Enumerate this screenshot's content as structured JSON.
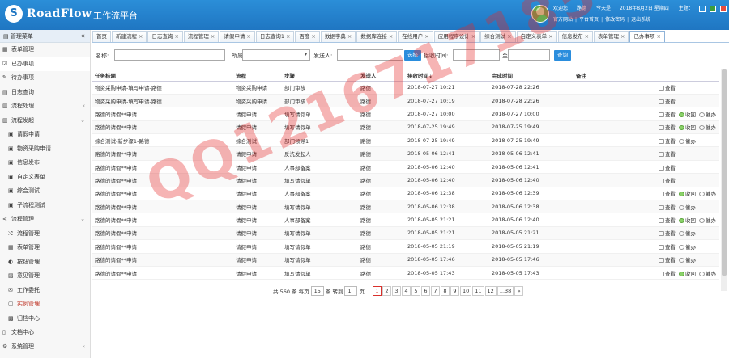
{
  "header": {
    "logo_glyph": "S",
    "brand": "RoadFlow",
    "brand_sub": "工作流平台",
    "welcome": "欢迎您：",
    "user": "路德",
    "today_label": "今天是：",
    "date": "2018年8月2日 星期四",
    "theme_label": "主题：",
    "links": [
      "官方网站",
      "平台首页",
      "修改密码",
      "退出系统"
    ],
    "theme_colors": [
      "#2b8ed8",
      "#3c9d3c",
      "#e74c3c"
    ]
  },
  "sidebar": {
    "title": "管理菜单",
    "items": [
      {
        "icon": "table-icon",
        "label": "表单管理",
        "level": 0
      },
      {
        "icon": "check-icon",
        "label": "已办事项",
        "level": 0,
        "active": true
      },
      {
        "icon": "edit-icon",
        "label": "待办事项",
        "level": 0
      },
      {
        "icon": "log-icon",
        "label": "日志查询",
        "level": 0
      },
      {
        "icon": "flow-icon",
        "label": "流程处理",
        "level": 0,
        "arrow": "‹"
      },
      {
        "icon": "flow-icon",
        "label": "流程发起",
        "level": 0,
        "arrow": "⌄"
      },
      {
        "icon": "doc-icon",
        "label": "请假申请",
        "level": 1
      },
      {
        "icon": "doc-icon",
        "label": "物资采购申请",
        "level": 1
      },
      {
        "icon": "doc-icon",
        "label": "信息发布",
        "level": 1
      },
      {
        "icon": "doc-icon",
        "label": "自定义表单",
        "level": 1
      },
      {
        "icon": "doc-icon",
        "label": "综合测试",
        "level": 1
      },
      {
        "icon": "doc-icon",
        "label": "子流程测试",
        "level": 1
      },
      {
        "icon": "share-icon",
        "label": "流程管理",
        "level": 0,
        "arrow": "⌄"
      },
      {
        "icon": "shuffle-icon",
        "label": "流程管理",
        "level": 1
      },
      {
        "icon": "table-icon",
        "label": "表单管理",
        "level": 1
      },
      {
        "icon": "toggle-icon",
        "label": "按钮管理",
        "level": 1
      },
      {
        "icon": "image-icon",
        "label": "意见管理",
        "level": 1
      },
      {
        "icon": "entrust-icon",
        "label": "工作委托",
        "level": 1
      },
      {
        "icon": "instance-icon",
        "label": "实例管理",
        "level": 1,
        "red": true
      },
      {
        "icon": "archive-icon",
        "label": "归档中心",
        "level": 1
      },
      {
        "icon": "file-icon",
        "label": "文档中心",
        "level": 0
      },
      {
        "icon": "gear-icon",
        "label": "系统管理",
        "level": 0,
        "arrow": "‹"
      }
    ]
  },
  "tabs": [
    "首页",
    "新建流程",
    "日志查询",
    "流程管理",
    "请假申请",
    "日志查询1",
    "百度",
    "数据字典",
    "数据库连接",
    "在线用户",
    "应用程序设计",
    "综合测试",
    "自定义表单",
    "信息发布",
    "表单管理",
    "已办事项"
  ],
  "search": {
    "name_label": "名称:",
    "flow_label": "所属流程:",
    "sender_label": "发送人:",
    "select_btn": "选择",
    "recv_time_label": "接收时间:",
    "to_label": "至",
    "query_btn": "查询"
  },
  "table": {
    "headers": [
      "任务标题",
      "流程",
      "步骤",
      "发送人",
      "接收时间",
      "完成时间",
      "备注",
      ""
    ],
    "sort_mark": "⇣",
    "action_labels": {
      "view": "查看",
      "withdraw": "收回",
      "urge": "催办"
    },
    "rows": [
      {
        "title": "物资采购申请-填写申请-路德",
        "flow": "物资采购申请",
        "step": "部门审核",
        "sender": "路德",
        "recv": "2018-07-27 10:21",
        "done": "2018-07-28 22:26",
        "actions": [
          "view"
        ]
      },
      {
        "title": "物资采购申请-填写申请-路德",
        "flow": "物资采购申请",
        "step": "部门审核",
        "sender": "路德",
        "recv": "2018-07-27 10:19",
        "done": "2018-07-28 22:26",
        "actions": [
          "view"
        ]
      },
      {
        "title": "路德的请假**申请",
        "flow": "请假申请",
        "step": "填写请假单",
        "sender": "路德",
        "recv": "2018-07-27 10:00",
        "done": "2018-07-27 10:00",
        "actions": [
          "view",
          "withdraw",
          "urge"
        ]
      },
      {
        "title": "路德的请假**申请",
        "flow": "请假申请",
        "step": "填写请假单",
        "sender": "路德",
        "recv": "2018-07-25 19:49",
        "done": "2018-07-25 19:49",
        "actions": [
          "view",
          "withdraw",
          "urge"
        ]
      },
      {
        "title": "综合测试-新步骤1-路德",
        "flow": "综合测试",
        "step": "部门领导1",
        "sender": "路德",
        "recv": "2018-07-25 19:49",
        "done": "2018-07-25 19:49",
        "actions": [
          "view",
          "urge"
        ]
      },
      {
        "title": "路德的请假**申请",
        "flow": "请假申请",
        "step": "反洗发起人",
        "sender": "路德",
        "recv": "2018-05-06 12:41",
        "done": "2018-05-06 12:41",
        "actions": [
          "view"
        ]
      },
      {
        "title": "路德的请假**申请",
        "flow": "请假申请",
        "step": "人事部备案",
        "sender": "路德",
        "recv": "2018-05-06 12:40",
        "done": "2018-05-06 12:41",
        "actions": [
          "view"
        ]
      },
      {
        "title": "路德的请假**申请",
        "flow": "请假申请",
        "step": "填写请假单",
        "sender": "路德",
        "recv": "2018-05-06 12:40",
        "done": "2018-05-06 12:40",
        "actions": [
          "view"
        ]
      },
      {
        "title": "路德的请假**申请",
        "flow": "请假申请",
        "step": "人事部备案",
        "sender": "路德",
        "recv": "2018-05-06 12:38",
        "done": "2018-05-06 12:39",
        "actions": [
          "view",
          "withdraw",
          "urge"
        ]
      },
      {
        "title": "路德的请假**申请",
        "flow": "请假申请",
        "step": "填写请假单",
        "sender": "路德",
        "recv": "2018-05-06 12:38",
        "done": "2018-05-06 12:38",
        "actions": [
          "view",
          "urge"
        ]
      },
      {
        "title": "路德的请假**申请",
        "flow": "请假申请",
        "step": "人事部备案",
        "sender": "路德",
        "recv": "2018-05-05 21:21",
        "done": "2018-05-06 12:40",
        "actions": [
          "view",
          "withdraw",
          "urge"
        ]
      },
      {
        "title": "路德的请假**申请",
        "flow": "请假申请",
        "step": "填写请假单",
        "sender": "路德",
        "recv": "2018-05-05 21:21",
        "done": "2018-05-05 21:21",
        "actions": [
          "view",
          "urge"
        ]
      },
      {
        "title": "路德的请假**申请",
        "flow": "请假申请",
        "step": "填写请假单",
        "sender": "路德",
        "recv": "2018-05-05 21:19",
        "done": "2018-05-05 21:19",
        "actions": [
          "view",
          "urge"
        ]
      },
      {
        "title": "路德的请假**申请",
        "flow": "请假申请",
        "step": "填写请假单",
        "sender": "路德",
        "recv": "2018-05-05 17:46",
        "done": "2018-05-05 17:46",
        "actions": [
          "view",
          "urge"
        ]
      },
      {
        "title": "路德的请假**申请",
        "flow": "请假申请",
        "step": "填写请假单",
        "sender": "路德",
        "recv": "2018-05-05 17:43",
        "done": "2018-05-05 17:43",
        "actions": [
          "view",
          "withdraw",
          "urge"
        ]
      }
    ]
  },
  "pager": {
    "total_prefix": "共 560 条 每页",
    "page_size": "15",
    "jump_label": "条 转到",
    "jump_value": "1",
    "page_suffix": "页",
    "pages": [
      "1",
      "2",
      "3",
      "4",
      "5",
      "6",
      "7",
      "8",
      "9",
      "10",
      "11",
      "12",
      "...38",
      "»"
    ],
    "current": "1"
  },
  "watermark": "QQ1216717185"
}
